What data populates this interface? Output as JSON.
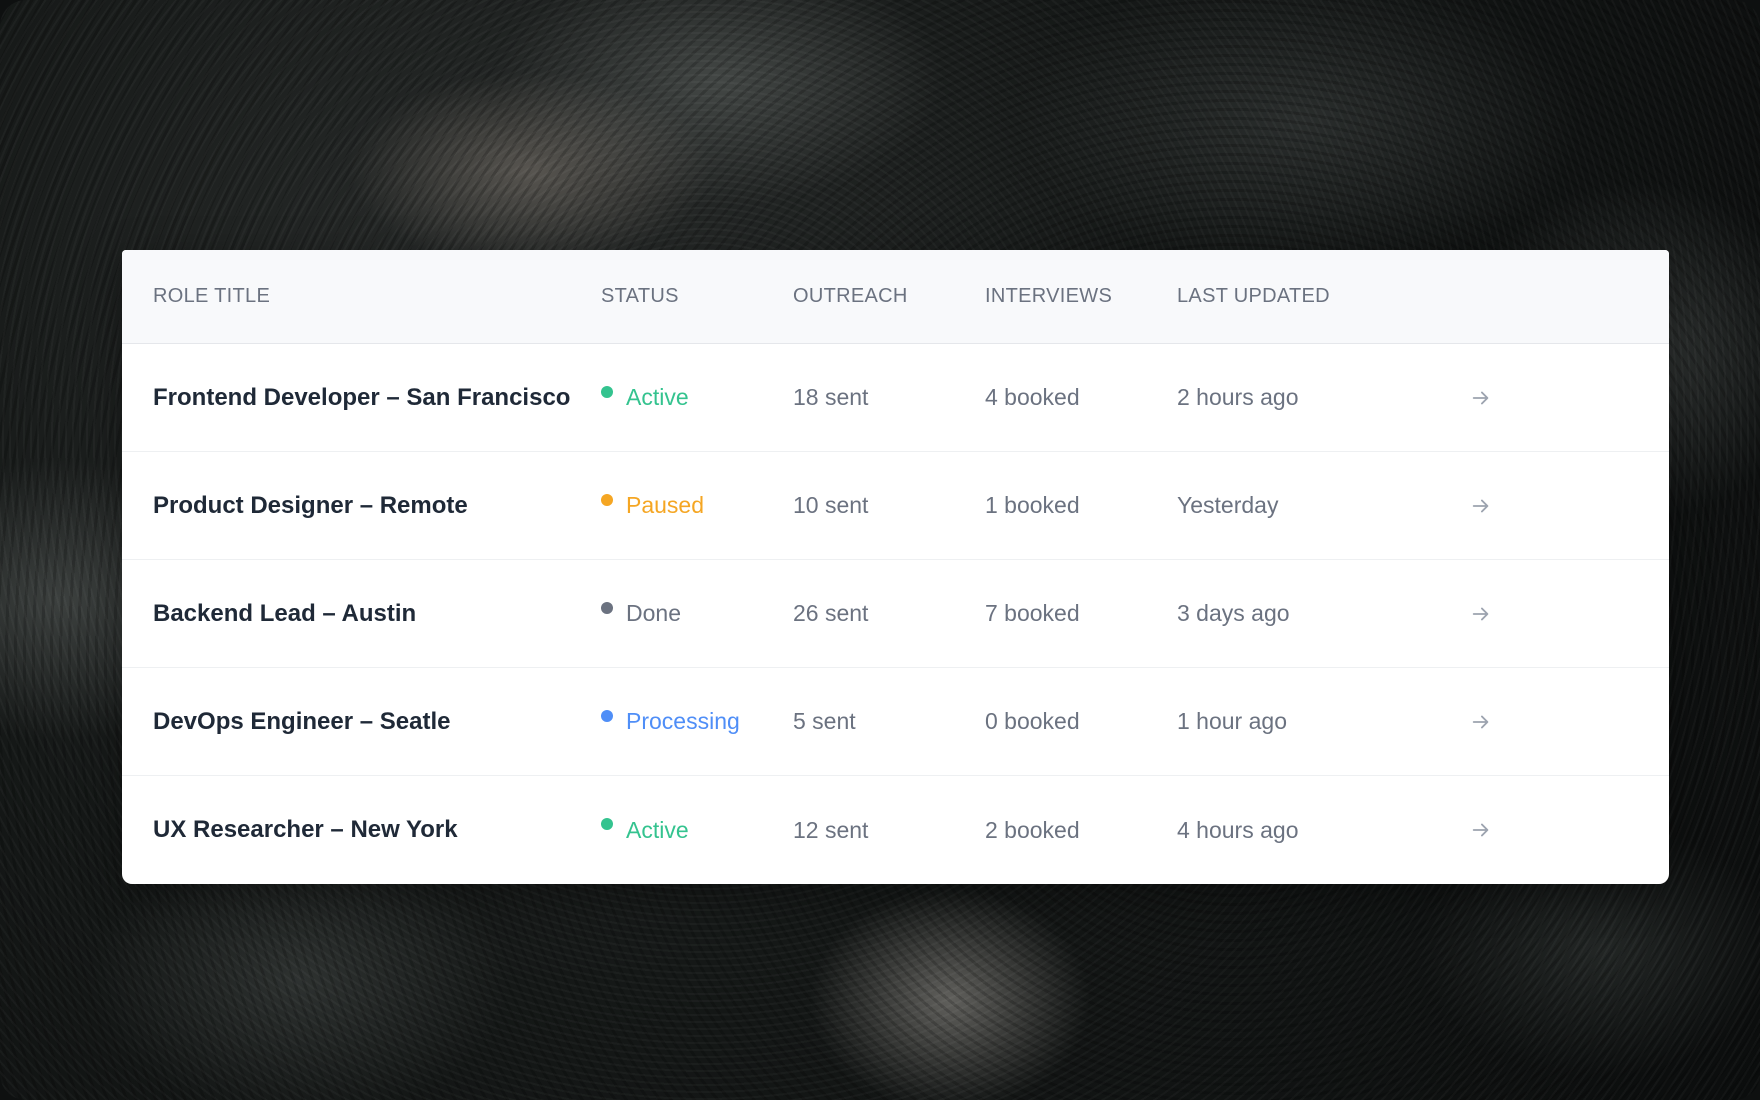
{
  "table": {
    "columns": {
      "role": "ROLE TITLE",
      "status": "STATUS",
      "outreach": "OUTREACH",
      "interviews": "INTERVIEWS",
      "updated": "LAST UPDATED"
    },
    "rows": [
      {
        "role": "Frontend Developer – San Francisco",
        "status": "Active",
        "status_color": "#34c38f",
        "outreach": "18 sent",
        "interviews": "4 booked",
        "updated": "2 hours ago",
        "action_icon": "arrow-right-icon"
      },
      {
        "role": "Product Designer – Remote",
        "status": "Paused",
        "status_color": "#f5a623",
        "outreach": "10 sent",
        "interviews": "1 booked",
        "updated": "Yesterday",
        "action_icon": "arrow-right-icon"
      },
      {
        "role": "Backend Lead – Austin",
        "status": "Done",
        "status_color": "#6b7280",
        "outreach": "26 sent",
        "interviews": "7 booked",
        "updated": "3 days ago",
        "action_icon": "arrow-right-icon"
      },
      {
        "role": "DevOps Engineer – Seatle",
        "status": "Processing",
        "status_color": "#4f8ef7",
        "outreach": "5 sent",
        "interviews": "0 booked",
        "updated": "1 hour ago",
        "action_icon": "arrow-right-icon"
      },
      {
        "role": "UX Researcher – New York",
        "status": "Active",
        "status_color": "#34c38f",
        "outreach": "12 sent",
        "interviews": "2 booked",
        "updated": "4 hours ago",
        "action_icon": "arrow-right-icon"
      }
    ]
  }
}
